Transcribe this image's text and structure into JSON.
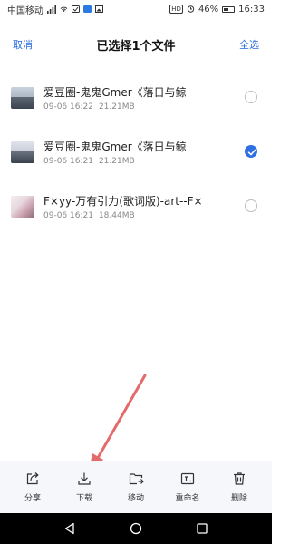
{
  "status_bar": {
    "carrier": "中国移动",
    "battery_percent": "46%",
    "time": "16:33",
    "hd": "HD"
  },
  "header": {
    "cancel": "取消",
    "title": "已选择1个文件",
    "select_all": "全选"
  },
  "files": [
    {
      "name": "爱豆圈-鬼鬼Gmer《落日与鲸",
      "date": "09-06 16:22",
      "size": "21.21MB",
      "selected": false
    },
    {
      "name": "爱豆圈-鬼鬼Gmer《落日与鲸",
      "date": "09-06 16:21",
      "size": "21.21MB",
      "selected": true
    },
    {
      "name": "F×yy-万有引力(歌词版)-art--F×",
      "date": "09-06 16:21",
      "size": "18.44MB",
      "selected": false
    }
  ],
  "toolbar": {
    "share": "分享",
    "download": "下载",
    "move": "移动",
    "rename": "重命名",
    "delete": "删除"
  },
  "colors": {
    "accent": "#2f6fe4",
    "annotation_arrow": "#e36b6b",
    "toolbar_bg": "#f5f7fb"
  },
  "icons": {
    "share": "share-icon",
    "download": "download-icon",
    "move": "move-folder-icon",
    "rename": "rename-icon",
    "delete": "trash-icon"
  }
}
